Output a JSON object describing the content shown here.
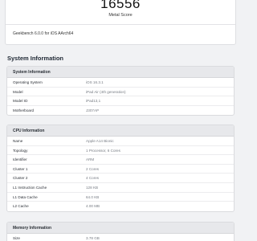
{
  "score": {
    "value": "16556",
    "label": "Metal Score",
    "version": "Geekbench 6.0.0 for iOS AArch64"
  },
  "system_information": {
    "title": "System Information",
    "system_card": {
      "header": "System Information",
      "rows": [
        {
          "key": "Operating System",
          "value": "iOS 16.3.1"
        },
        {
          "key": "Model",
          "value": "iPad Air (4th generation)"
        },
        {
          "key": "Model ID",
          "value": "iPad13,1"
        },
        {
          "key": "Motherboard",
          "value": "J307AP"
        }
      ]
    },
    "cpu_card": {
      "header": "CPU Information",
      "rows": [
        {
          "key": "Name",
          "value": "Apple A14 Bionic"
        },
        {
          "key": "Topology",
          "value": "1 Processor, 6 Cores"
        },
        {
          "key": "Identifier",
          "value": "ARM"
        },
        {
          "key": "Cluster 1",
          "value": "2 Cores"
        },
        {
          "key": "Cluster 2",
          "value": "4 Cores"
        },
        {
          "key": "L1 Instruction Cache",
          "value": "128 KB"
        },
        {
          "key": "L1 Data Cache",
          "value": "64.0 KB"
        },
        {
          "key": "L2 Cache",
          "value": "4.00 MB"
        }
      ]
    },
    "memory_card": {
      "header": "Memory Information",
      "rows": [
        {
          "key": "Size",
          "value": "3.78 GB"
        }
      ]
    }
  }
}
